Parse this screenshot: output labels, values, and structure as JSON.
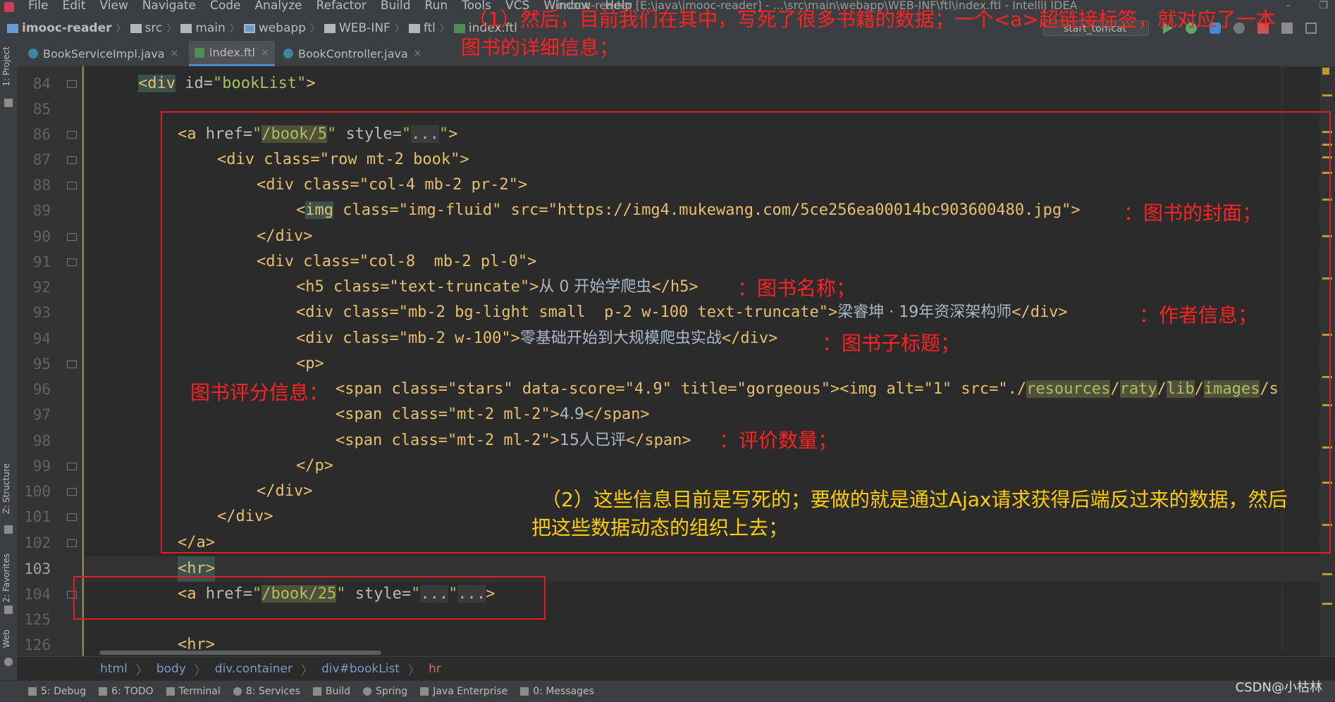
{
  "window": {
    "title": "imooc-reader [E:\\java\\imooc-reader] - ...\\src\\main\\webapp\\WEB-INF\\ftl\\index.ftl - IntelliJ IDEA"
  },
  "menu": [
    "File",
    "Edit",
    "View",
    "Navigate",
    "Code",
    "Analyze",
    "Refactor",
    "Build",
    "Run",
    "Tools",
    "VCS",
    "Window",
    "Help"
  ],
  "breadcrumb": [
    "imooc-reader",
    "src",
    "main",
    "webapp",
    "WEB-INF",
    "ftl",
    "index.ftl"
  ],
  "run_config": "start_tomcat",
  "tabs": [
    {
      "label": "BookServiceImpl.java",
      "icon": "java-class-icon",
      "active": false
    },
    {
      "label": "index.ftl",
      "icon": "ftl-file-icon",
      "active": true
    },
    {
      "label": "BookController.java",
      "icon": "java-class-icon",
      "active": false
    }
  ],
  "tool_windows_left": [
    "1: Project",
    "Z: Structure",
    "2: Favorites",
    "Web"
  ],
  "line_numbers": [
    "84",
    "85",
    "86",
    "87",
    "88",
    "89",
    "90",
    "91",
    "92",
    "93",
    "94",
    "95",
    "96",
    "97",
    "98",
    "99",
    "100",
    "101",
    "102",
    "103",
    "104",
    "125",
    "126"
  ],
  "current_line": "103",
  "code": {
    "l84_tag_open": "<div",
    "l84_attr": " id=",
    "l84_val": "\"bookList\"",
    "l84_close": ">",
    "l86_a": "<a",
    "l86_href": " href=",
    "l86_q1": "\"",
    "l86_hrefval": "/book/5",
    "l86_q2": "\"",
    "l86_style": " style=",
    "l86_sq1": "\"",
    "l86_dots": "...",
    "l86_sq2": "\"",
    "l86_close": ">",
    "l87": "<div class=\"row mt-2 book\">",
    "l88": "<div class=\"col-4 mb-2 pr-2\">",
    "l89_lt": "<",
    "l89_img": "img",
    "l89_rest": " class=\"img-fluid\" src=\"https://img4.mukewang.com/5ce256ea00014bc903600480.jpg\">",
    "l90": "</div>",
    "l91": "<div class=\"col-8  mb-2 pl-0\">",
    "l92_open": "<h5 class=\"text-truncate\">",
    "l92_text": "从 0 开始学爬虫",
    "l92_close": "</h5>",
    "l93_open": "<div class=\"mb-2 bg-light small  p-2 w-100 text-truncate\">",
    "l93_text": "梁睿坤 · 19年资深架构师",
    "l93_close": "</div>",
    "l94_open": "<div class=\"mb-2 w-100\">",
    "l94_text": "零基础开始到大规模爬虫实战",
    "l94_close": "</div>",
    "l95": "<p>",
    "l96_open": "<span class=\"stars\" data-score=\"4.9\" title=\"gorgeous\"><img alt=\"1\" src=\"./",
    "l96_p1": "resources",
    "l96_s1": "/",
    "l96_p2": "raty",
    "l96_s2": "/",
    "l96_p3": "lib",
    "l96_s3": "/",
    "l96_p4": "images",
    "l96_s4": "/s",
    "l97_open": "<span class=\"mt-2 ml-2\">",
    "l97_text": "4.9",
    "l97_close": "</span>",
    "l98_open": "<span class=\"mt-2 ml-2\">",
    "l98_text": "15人已评",
    "l98_close": "</span>",
    "l99": "</p>",
    "l100": "</div>",
    "l101": "</div>",
    "l102": "</a>",
    "l103": "<hr>",
    "l104_a": "<a",
    "l104_href": " href=",
    "l104_hrefval": "/book/25",
    "l104_style": " style=",
    "l104_dots1": "...",
    "l104_dots2": "...",
    "l104_close": ">",
    "l126": "<hr>"
  },
  "annotations": {
    "top_1": "（1）然后，目前我们在其中，写死了很多书籍的数据；一个<a>超链接标签，就对应了一本",
    "top_2": "图书的详细信息；",
    "cover": "：图书的封面；",
    "name": "：图书名称；",
    "author": "：作者信息；",
    "subtitle": "：图书子标题；",
    "rating": "图书评分信息：",
    "count": "：评价数量；",
    "note_1": "（2）这些信息目前是写死的；要做的就是通过Ajax请求获得后端反过来的数据，然后",
    "note_2": "把这些数据动态的组织上去；"
  },
  "structure_breadcrumb": [
    "html",
    "body",
    "div.container",
    "div#bookList",
    "hr"
  ],
  "status_tools": [
    "5: Debug",
    "6: TODO",
    "Terminal",
    "8: Services",
    "Build",
    "Spring",
    "Java Enterprise",
    "0: Messages"
  ],
  "watermark": "CSDN@小枯林"
}
